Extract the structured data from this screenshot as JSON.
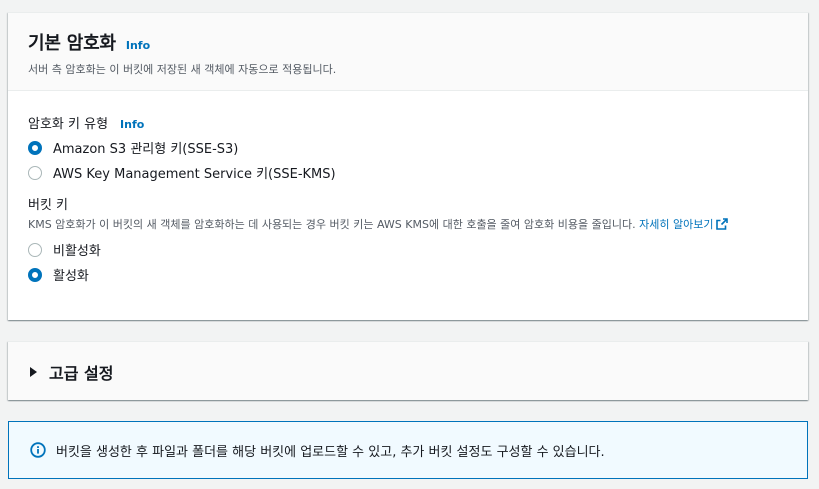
{
  "encryption": {
    "title": "기본 암호화",
    "info": "Info",
    "description": "서버 측 암호화는 이 버킷에 저장된 새 객체에 자동으로 적용됩니다.",
    "key_type": {
      "label": "암호화 키 유형",
      "info": "Info",
      "options": [
        {
          "label": "Amazon S3 관리형 키(SSE-S3)",
          "selected": true
        },
        {
          "label": "AWS Key Management Service 키(SSE-KMS)",
          "selected": false
        }
      ]
    },
    "bucket_key": {
      "label": "버킷 키",
      "description": "KMS 암호화가 이 버킷의 새 객체를 암호화하는 데 사용되는 경우 버킷 키는 AWS KMS에 대한 호출을 줄여 암호화 비용을 줄입니다.",
      "learn_more": "자세히 알아보기",
      "options": [
        {
          "label": "비활성화",
          "selected": false
        },
        {
          "label": "활성화",
          "selected": true
        }
      ]
    }
  },
  "advanced": {
    "title": "고급 설정"
  },
  "alert": {
    "icon": "info-circle-icon",
    "text": "버킷을 생성한 후 파일과 폴더를 해당 버킷에 업로드할 수 있고, 추가 버킷 설정도 구성할 수 있습니다."
  },
  "colors": {
    "accent": "#0073bb",
    "background": "#f2f3f3",
    "alert_bg": "#f1faff"
  }
}
